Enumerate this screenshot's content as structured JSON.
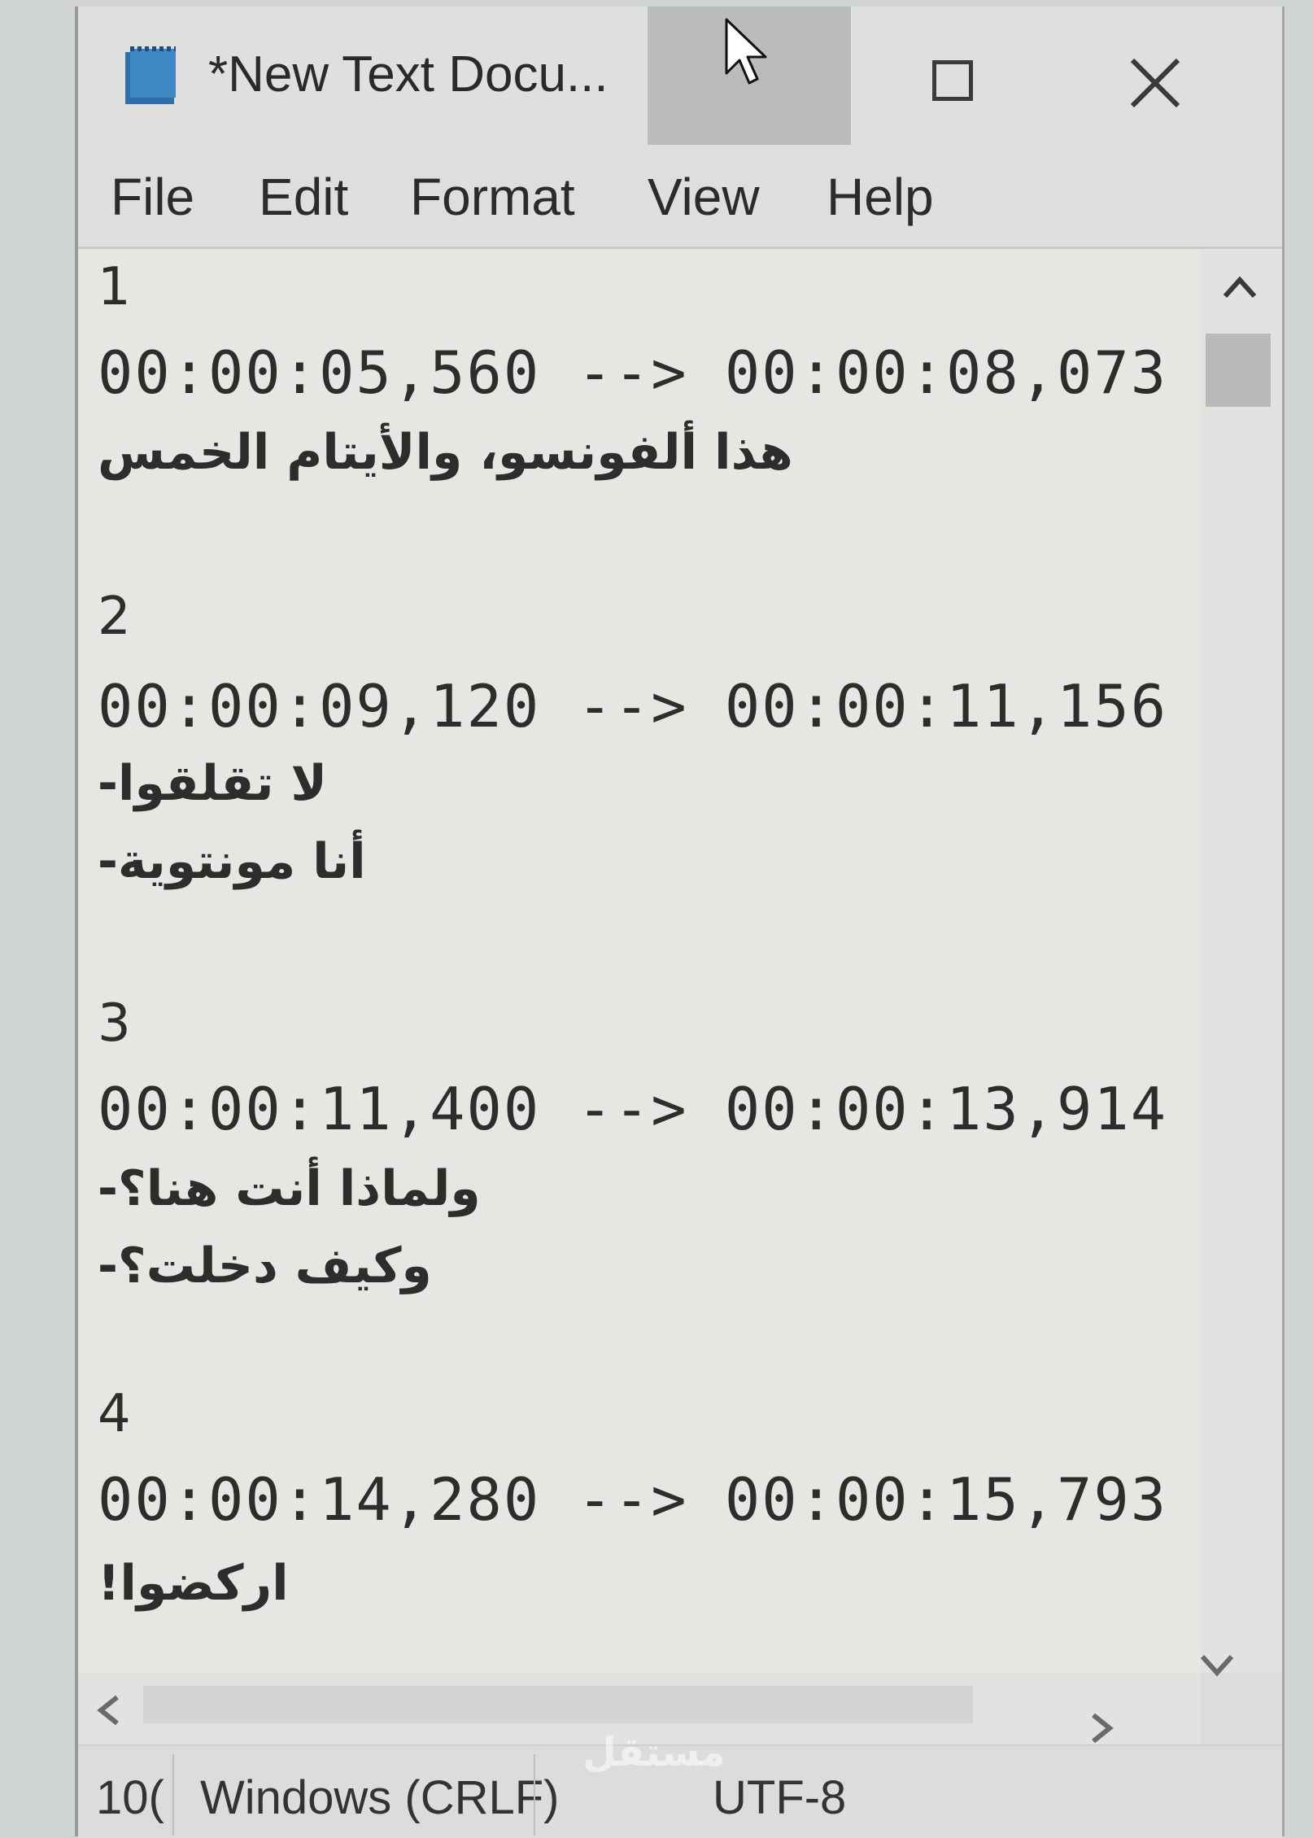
{
  "window": {
    "title": "*New Text Docu..."
  },
  "menu": {
    "items": [
      "File",
      "Edit",
      "Format",
      "View",
      "Help"
    ]
  },
  "editor": {
    "lines": {
      "n1": "1",
      "t1": "00:00:05,560 --> 00:00:08,073",
      "a1": "هذا ألفونسو، والأيتام الخمس",
      "n2": "2",
      "t2": "00:00:09,120 --> 00:00:11,156",
      "a2a": "-لا تقلقوا",
      "a2b": "-أنا مونتوية",
      "n3": "3",
      "t3": "00:00:11,400 --> 00:00:13,914",
      "a3a": "-ولماذا أنت هنا؟",
      "a3b": "-وكيف دخلت؟",
      "n4": "4",
      "t4": "00:00:14,280 --> 00:00:15,793",
      "a4": "!اركضوا"
    }
  },
  "statusbar": {
    "zoom": "10(",
    "line_ending": "Windows (CRLF)",
    "encoding": "UTF-8"
  },
  "watermark": "مستقل",
  "colors": {
    "window_bg": "#dddddb",
    "editor_bg": "#e7e6e3",
    "minimize_highlight": "#b9bbbc",
    "text": "#2d2d2d"
  },
  "icons": [
    "notepad-icon",
    "mouse-cursor-icon",
    "maximize-icon",
    "close-icon",
    "scroll-up-icon",
    "scroll-down-icon",
    "scroll-left-icon",
    "scroll-right-icon"
  ]
}
